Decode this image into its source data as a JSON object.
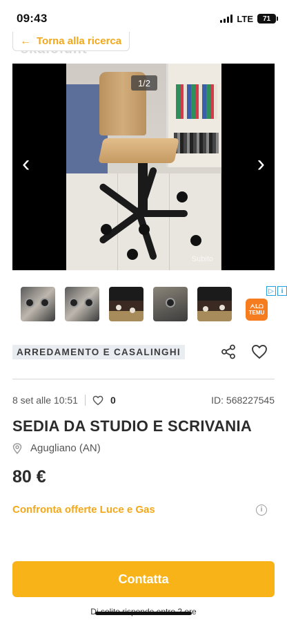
{
  "status_bar": {
    "time": "09:43",
    "network": "LTE",
    "battery": "71"
  },
  "nav": {
    "back_label": "Torna alla ricerca",
    "watermark": "skaloiu.it"
  },
  "gallery": {
    "counter": "1/2",
    "photo_watermark": "Subito"
  },
  "ad": {
    "advertiser_label": "TEMU",
    "advertiser_sub": "ᗅᒪᗝ"
  },
  "listing": {
    "category": "ARREDAMENTO E CASALINGHI",
    "date": "8 set alle 10:51",
    "favorites": "0",
    "id": "ID: 568227545",
    "title": "SEDIA DA STUDIO E SCRIVANIA",
    "location": "Agugliano (AN)",
    "price": "80 €",
    "offer_link": "Confronta offerte Luce e Gas"
  },
  "footer": {
    "contact_label": "Contatta",
    "reply_note": "Di solito risponde entro 2 ore"
  },
  "colors": {
    "accent": "#f7b318",
    "link": "#f3a81a",
    "chip_bg": "#e9edf2"
  }
}
